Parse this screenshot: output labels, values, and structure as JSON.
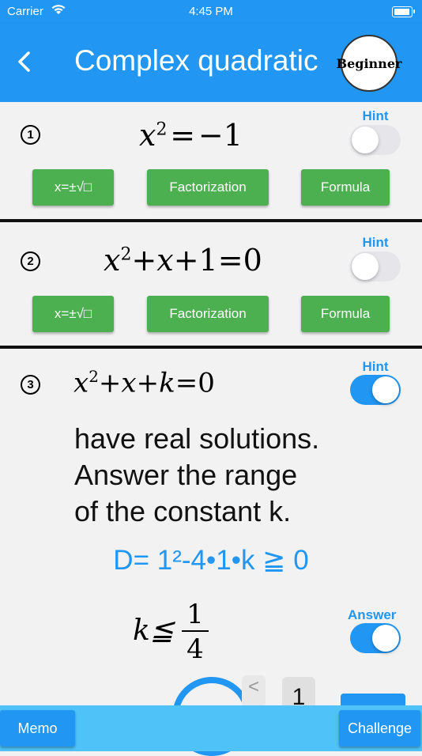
{
  "status_bar": {
    "carrier": "Carrier",
    "time": "4:45 PM"
  },
  "header": {
    "title": "Complex quadratic",
    "level_badge": "Beginner"
  },
  "problems": [
    {
      "number": "1",
      "equation": "x² = −1",
      "hint_label": "Hint",
      "hint_on": false,
      "buttons": [
        "x=±√□",
        "Factorization",
        "Formula"
      ]
    },
    {
      "number": "2",
      "equation": "x² + x + 1 = 0",
      "hint_label": "Hint",
      "hint_on": false,
      "buttons": [
        "x=±√□",
        "Factorization",
        "Formula"
      ]
    },
    {
      "number": "3",
      "equation": "x² + x + k = 0",
      "hint_label": "Hint",
      "hint_on": true,
      "text": "have real solutions.\nAnswer the range\nof the constant k.",
      "hint": "D= 1²-4•1•k ≧ 0",
      "answer_label": "Answer",
      "answer_on": true,
      "answer_lhs": "k≦",
      "answer_numerator": "1",
      "answer_denominator": "4"
    }
  ],
  "partial_row": {
    "arrow": "<",
    "number": "1"
  },
  "bottom_bar": {
    "memo": "Memo",
    "challenge": "Challenge"
  },
  "colors": {
    "primary": "#2196f3",
    "button_green": "#4caf50",
    "bottom_bar": "#4fc3f7"
  }
}
